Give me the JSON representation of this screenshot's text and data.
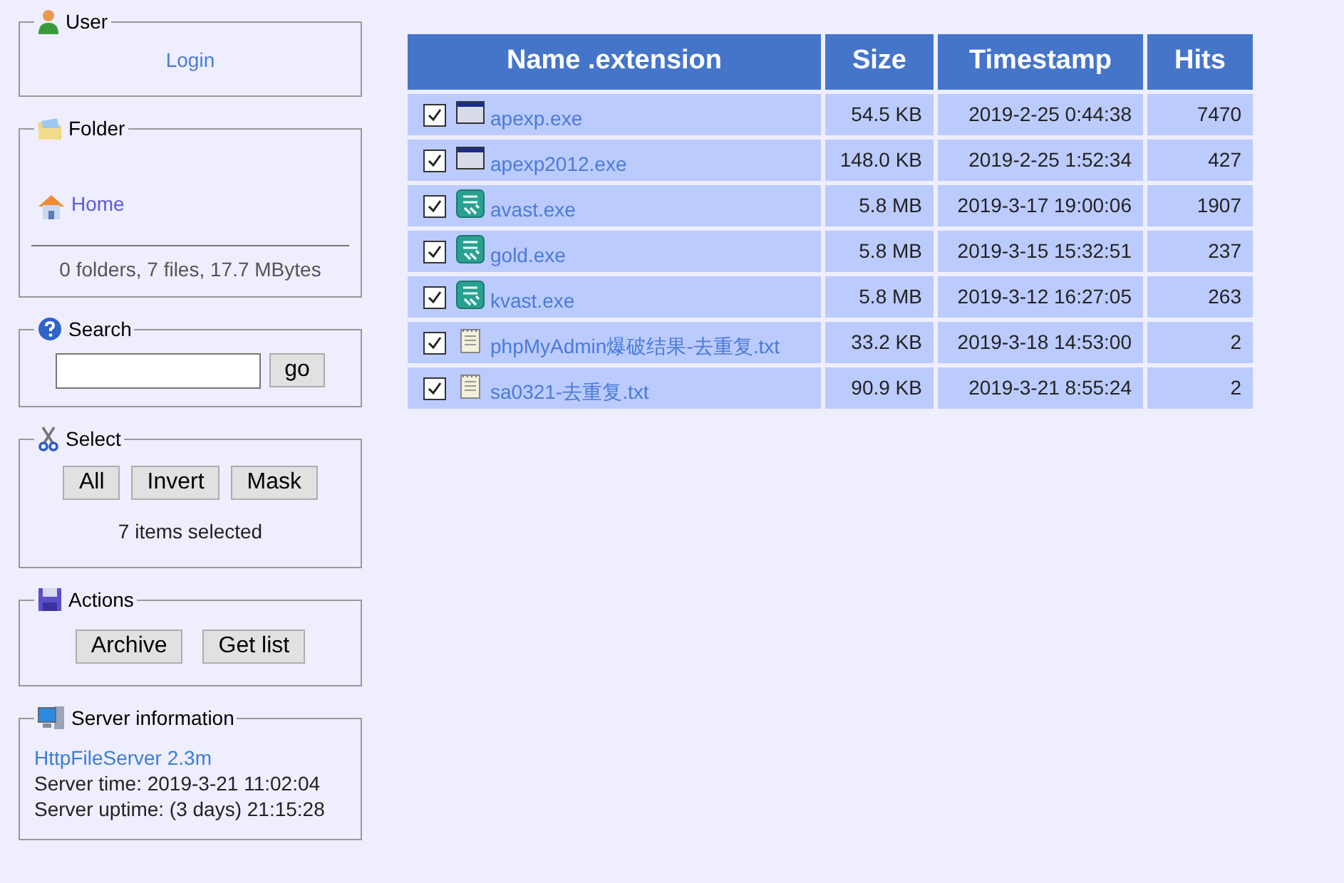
{
  "panels": [
    {
      "kind": "user",
      "title": "User",
      "login": "Login"
    },
    {
      "kind": "folder",
      "title": "Folder",
      "home": "Home",
      "summary": "0 folders, 7 files, 17.7 MBytes"
    },
    {
      "kind": "search",
      "title": "Search",
      "button": "go"
    },
    {
      "kind": "select",
      "title": "Select",
      "buttons": [
        "All",
        "Invert",
        "Mask"
      ],
      "status": "7 items selected"
    },
    {
      "kind": "actions",
      "title": "Actions",
      "buttons": [
        "Archive",
        "Get list"
      ]
    },
    {
      "kind": "server",
      "title": "Server information",
      "link": "HttpFileServer 2.3m",
      "lines": [
        "Server time: 2019-3-21 11:02:04",
        "Server uptime: (3 days) 21:15:28"
      ]
    }
  ],
  "table": {
    "columns": [
      "Name .extension",
      "Size",
      "Timestamp",
      "Hits"
    ],
    "rows": [
      {
        "checked": true,
        "kind": "program",
        "name": "apexp.exe",
        "size": "54.5 KB",
        "timestamp": "2019-2-25 0:44:38",
        "hits": "7470"
      },
      {
        "checked": true,
        "kind": "program",
        "name": "apexp2012.exe",
        "size": "148.0 KB",
        "timestamp": "2019-2-25 1:52:34",
        "hits": "427"
      },
      {
        "checked": true,
        "kind": "installer",
        "name": "avast.exe",
        "size": "5.8 MB",
        "timestamp": "2019-3-17 19:00:06",
        "hits": "1907"
      },
      {
        "checked": true,
        "kind": "installer",
        "name": "gold.exe",
        "size": "5.8 MB",
        "timestamp": "2019-3-15 15:32:51",
        "hits": "237"
      },
      {
        "checked": true,
        "kind": "installer",
        "name": "kvast.exe",
        "size": "5.8 MB",
        "timestamp": "2019-3-12 16:27:05",
        "hits": "263"
      },
      {
        "checked": true,
        "kind": "text",
        "name": "phpMyAdmin爆破结果-去重复.txt",
        "size": "33.2 KB",
        "timestamp": "2019-3-18 14:53:00",
        "hits": "2"
      },
      {
        "checked": true,
        "kind": "text",
        "name": "sa0321-去重复.txt",
        "size": "90.9 KB",
        "timestamp": "2019-3-21 8:55:24",
        "hits": "2"
      }
    ]
  }
}
